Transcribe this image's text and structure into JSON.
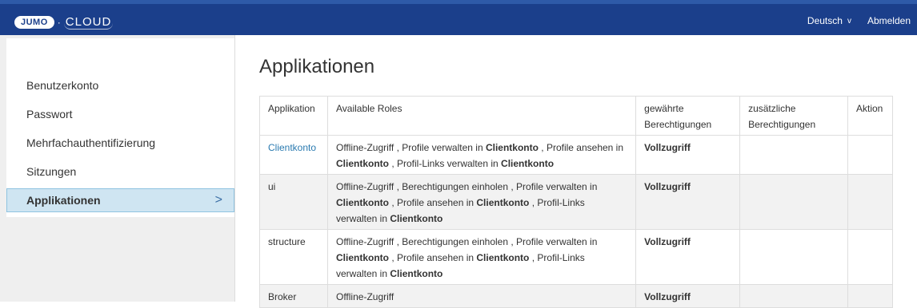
{
  "header": {
    "logo_badge": "JUMO",
    "logo_separator": "·",
    "logo_text": "CLOUD",
    "language": "Deutsch",
    "language_chevron": "v",
    "logout": "Abmelden"
  },
  "sidebar": {
    "items": [
      {
        "label": "Benutzerkonto"
      },
      {
        "label": "Passwort"
      },
      {
        "label": "Mehrfachauthentifizierung"
      },
      {
        "label": "Sitzungen"
      },
      {
        "label": "Applikationen",
        "active": true
      }
    ],
    "active_arrow": ">"
  },
  "main": {
    "title": "Applikationen",
    "table": {
      "headers": [
        "Applikation",
        "Available Roles",
        "gewährte Berechtigungen",
        "zusätzliche Berechtigungen",
        "Aktion"
      ],
      "rows": [
        {
          "application": "Clientkonto",
          "roles": [
            {
              "text": "Offline-Zugriff , Profile verwalten in ",
              "bold": false
            },
            {
              "text": "Clientkonto",
              "bold": true
            },
            {
              "text": " , Profile ansehen in ",
              "bold": false
            },
            {
              "text": "Clientkonto",
              "bold": true
            },
            {
              "text": " , Profil-Links verwalten in ",
              "bold": false
            },
            {
              "text": "Clientkonto",
              "bold": true
            }
          ],
          "granted": "Vollzugriff",
          "additional": "",
          "action": ""
        },
        {
          "application": "ui",
          "roles": [
            {
              "text": "Offline-Zugriff , Berechtigungen einholen , Profile verwalten in ",
              "bold": false
            },
            {
              "text": "Clientkonto",
              "bold": true
            },
            {
              "text": " , Profile ansehen in ",
              "bold": false
            },
            {
              "text": "Clientkonto",
              "bold": true
            },
            {
              "text": " , Profil-Links verwalten in ",
              "bold": false
            },
            {
              "text": "Clientkonto",
              "bold": true
            }
          ],
          "granted": "Vollzugriff",
          "additional": "",
          "action": ""
        },
        {
          "application": "structure",
          "roles": [
            {
              "text": "Offline-Zugriff , Berechtigungen einholen , Profile verwalten in ",
              "bold": false
            },
            {
              "text": "Clientkonto",
              "bold": true
            },
            {
              "text": " , Profile ansehen in ",
              "bold": false
            },
            {
              "text": "Clientkonto",
              "bold": true
            },
            {
              "text": " , Profil-Links verwalten in ",
              "bold": false
            },
            {
              "text": "Clientkonto",
              "bold": true
            }
          ],
          "granted": "Vollzugriff",
          "additional": "",
          "action": ""
        },
        {
          "application": "Broker",
          "roles": [
            {
              "text": "Offline-Zugriff",
              "bold": false
            }
          ],
          "granted": "Vollzugriff",
          "additional": "",
          "action": ""
        }
      ]
    }
  },
  "colors": {
    "header_bg": "#1b3f8b",
    "active_item_bg": "#cfe5f2",
    "link": "#2a7ab0"
  }
}
